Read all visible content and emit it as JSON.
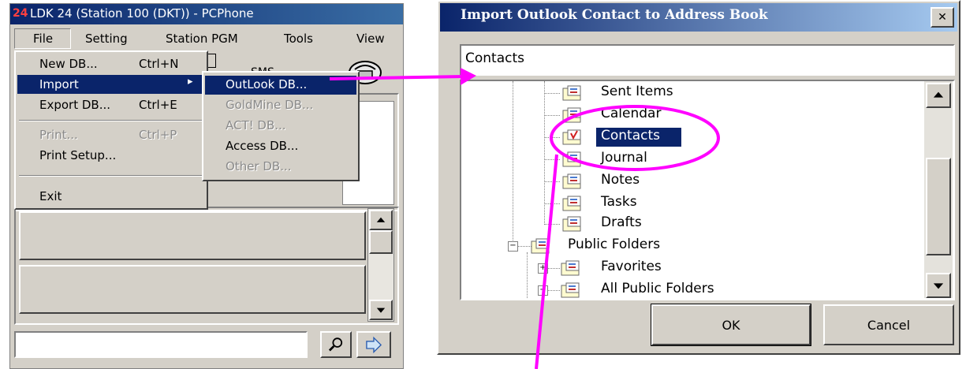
{
  "left_window": {
    "title_icon": "24",
    "title": "LDK 24 (Station 100 (DKT)) - PCPhone",
    "menubar": [
      "File",
      "Setting",
      "Station PGM",
      "Tools",
      "View"
    ],
    "toolbar": {
      "sms_label": "SMS"
    }
  },
  "file_menu": {
    "items": [
      {
        "label": "New DB...",
        "shortcut": "Ctrl+N"
      },
      {
        "label": "Import",
        "shortcut": "▸"
      },
      {
        "label": "Export DB...",
        "shortcut": "Ctrl+E"
      },
      {
        "label": "Print...",
        "shortcut": "Ctrl+P"
      },
      {
        "label": "Print Setup..."
      },
      {
        "label": "Exit"
      }
    ]
  },
  "import_submenu": {
    "items": [
      "OutLook DB...",
      "GoldMine DB...",
      "ACT! DB...",
      "Access DB...",
      "Other DB..."
    ]
  },
  "dialog": {
    "title": "Import Outlook Contact to Address Book",
    "close_glyph": "✕",
    "folder_value": "Contacts",
    "tree": [
      "Sent Items",
      "Calendar",
      "Contacts",
      "Journal",
      "Notes",
      "Tasks",
      "Drafts",
      "Public Folders",
      "Favorites",
      "All Public Folders"
    ],
    "ok_label": "OK",
    "cancel_label": "Cancel"
  },
  "colors": {
    "titlebar": "#0a246a",
    "highlight": "#0a246a",
    "annotation": "#ff00ff",
    "face": "#d4d0c8"
  }
}
